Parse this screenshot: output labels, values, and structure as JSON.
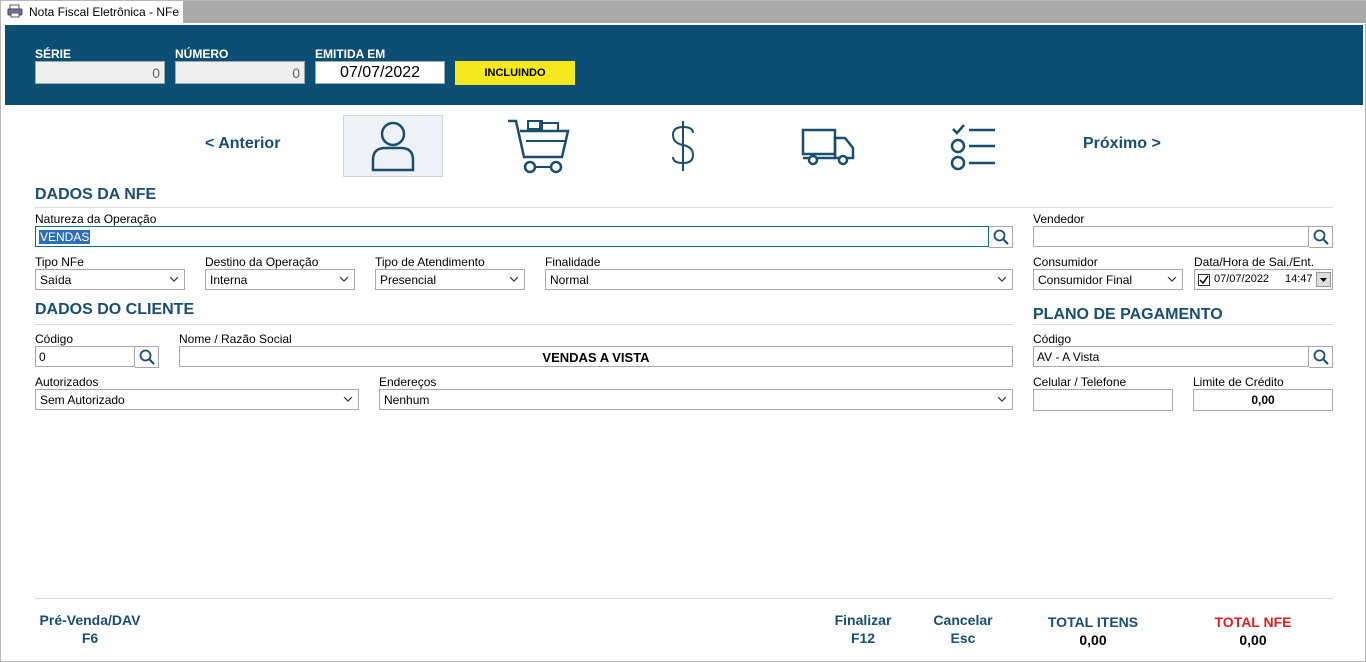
{
  "window": {
    "title": "Nota Fiscal Eletrônica - NFe"
  },
  "header": {
    "serie_label": "SÉRIE",
    "serie_value": "0",
    "numero_label": "NÚMERO",
    "numero_value": "0",
    "emitida_label": "EMITIDA EM",
    "emitida_value": "07/07/2022",
    "status": "INCLUINDO"
  },
  "nav": {
    "prev": "< Anterior",
    "next": "Próximo >"
  },
  "steps": [
    {
      "icon": "user-icon"
    },
    {
      "icon": "cart-icon"
    },
    {
      "icon": "dollar-icon"
    },
    {
      "icon": "truck-icon"
    },
    {
      "icon": "checklist-icon"
    }
  ],
  "nfe": {
    "section": "DADOS DA NFE",
    "natureza_label": "Natureza da Operação",
    "natureza_value": "VENDAS",
    "vendedor_label": "Vendedor",
    "vendedor_value": "",
    "tipo_label": "Tipo NFe",
    "tipo_value": "Saída",
    "destino_label": "Destino da Operação",
    "destino_value": "Interna",
    "atendimento_label": "Tipo de Atendimento",
    "atendimento_value": "Presencial",
    "finalidade_label": "Finalidade",
    "finalidade_value": "Normal",
    "consumidor_label": "Consumidor",
    "consumidor_value": "Consumidor Final",
    "datahora_label": "Data/Hora de Sai./Ent.",
    "data_value": "07/07/2022",
    "hora_value": "14:47"
  },
  "cliente": {
    "section": "DADOS DO CLIENTE",
    "codigo_label": "Código",
    "codigo_value": "0",
    "nome_label": "Nome / Razão Social",
    "nome_value": "VENDAS A VISTA",
    "autorizados_label": "Autorizados",
    "autorizados_value": "Sem Autorizado",
    "enderecos_label": "Endereços",
    "enderecos_value": "Nenhum"
  },
  "pagamento": {
    "section": "PLANO DE PAGAMENTO",
    "codigo_label": "Código",
    "codigo_value": "AV - A Vista",
    "celular_label": "Celular / Telefone",
    "celular_value": "",
    "limite_label": "Limite de Crédito",
    "limite_value": "0,00"
  },
  "footer": {
    "prevenda_line1": "Pré-Venda/DAV",
    "prevenda_line2": "F6",
    "finalizar_line1": "Finalizar",
    "finalizar_line2": "F12",
    "cancelar_line1": "Cancelar",
    "cancelar_line2": "Esc",
    "total_itens_label": "TOTAL ITENS",
    "total_itens_value": "0,00",
    "total_nfe_label": "TOTAL NFE",
    "total_nfe_value": "0,00"
  },
  "colors": {
    "header_bg": "#0d4f74",
    "accent_text": "#1a4e6e",
    "status_bg": "#f5e81e",
    "total_nfe": "#e02020"
  }
}
